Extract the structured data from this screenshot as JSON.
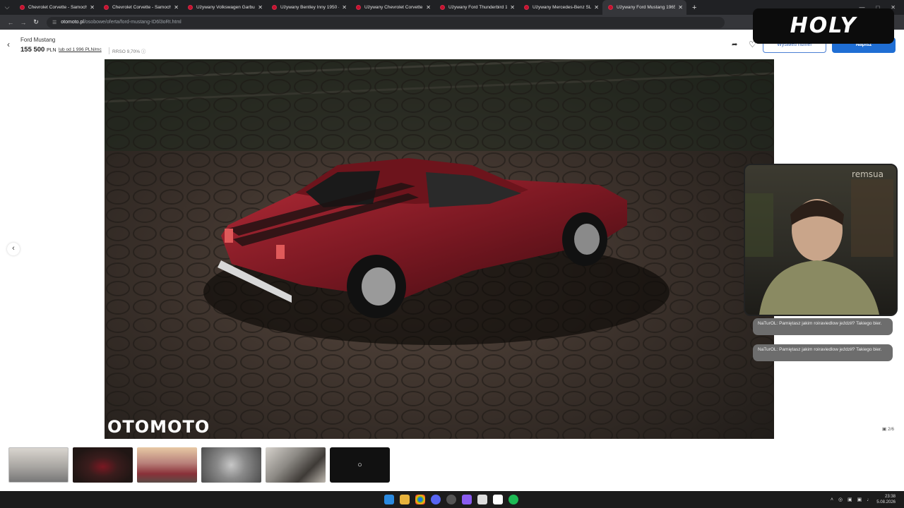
{
  "browser": {
    "tabs": [
      {
        "label": "Chevrolet Corvette - Samochod",
        "active": false
      },
      {
        "label": "Chevrolet Corvette - Samochod",
        "active": false
      },
      {
        "label": "Używany Volkswagen Garbus 1",
        "active": false
      },
      {
        "label": "Używany Bentley Inny 1950 - 6",
        "active": false
      },
      {
        "label": "Używany Chevrolet Corvette 19",
        "active": false
      },
      {
        "label": "Używany Ford Thunderbird 19",
        "active": false
      },
      {
        "label": "Używany Mercedes-Benz SL 19",
        "active": false
      },
      {
        "label": "Używany Ford Mustang 1965 -",
        "active": true
      }
    ],
    "new_tab": "+",
    "url_host": "otomoto.pl",
    "url_path": "/osobowe/oferta/ford-mustang-ID6l3oRt.html"
  },
  "listing": {
    "title": "Ford Mustang",
    "price": "155 500",
    "currency": "PLN",
    "installment": "lub od 1 996 PLN/mc",
    "rrso": "RRSO 9,70%",
    "show_phone": "Wyświetl numer",
    "write": "Napisz",
    "photo_counter": "2/6",
    "watermark": "OTOMOTO"
  },
  "thumbnails": [
    {
      "name": "thumb-1"
    },
    {
      "name": "thumb-2"
    },
    {
      "name": "thumb-3"
    },
    {
      "name": "thumb-4"
    },
    {
      "name": "thumb-5"
    },
    {
      "name": "thumb-6"
    }
  ],
  "overlay": {
    "holy_logo": "HOLY",
    "webcam_label": "remsua",
    "chat": [
      {
        "text": "NaTurOL: Pamiętasz jakim roiraviedlow jeździł? Takiego bier."
      },
      {
        "text": "NaTurOL: Pamiętasz jakim roiraviedlow jeździł? Takiego bier."
      }
    ]
  },
  "taskbar": {
    "time": "23:38",
    "date": "5.08.2026"
  },
  "colors": {
    "accent": "#1f6ed4",
    "car": "#7a1822"
  }
}
